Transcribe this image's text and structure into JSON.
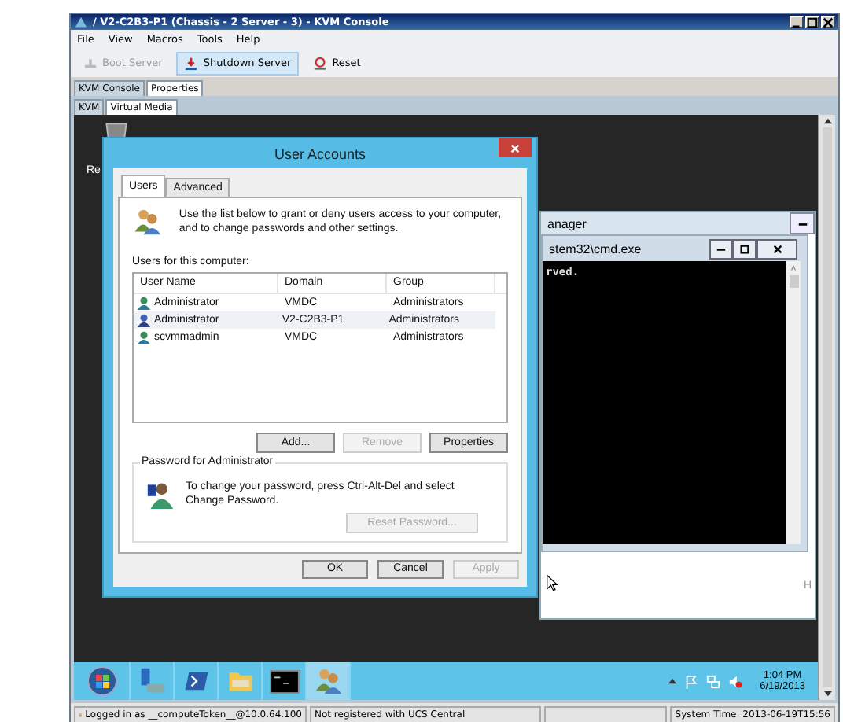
{
  "window": {
    "title": "/ V2-C2B3-P1 (Chassis - 2 Server - 3) - KVM Console"
  },
  "menu": [
    "File",
    "View",
    "Macros",
    "Tools",
    "Help"
  ],
  "toolbar": [
    {
      "label": "Boot Server",
      "kind": "boot",
      "disabled": true,
      "highlighted": false
    },
    {
      "label": "Shutdown Server",
      "kind": "shutdown",
      "disabled": false,
      "highlighted": true
    },
    {
      "label": "Reset",
      "kind": "reset",
      "disabled": false,
      "highlighted": false
    }
  ],
  "tabs": [
    {
      "label": "KVM Console",
      "selected": false
    },
    {
      "label": "Properties",
      "selected": true
    }
  ],
  "subtabs": [
    {
      "label": "KVM",
      "selected": false
    },
    {
      "label": "Virtual Media",
      "selected": true
    }
  ],
  "desktop": {
    "recycle_bin_label": "Re",
    "server_manager": {
      "title": "anager",
      "side_text": "H"
    },
    "cmd": {
      "title": "stem32\\cmd.exe",
      "text": "rved."
    }
  },
  "dialog": {
    "title": "User Accounts",
    "tabs": [
      {
        "label": "Users",
        "selected": true
      },
      {
        "label": "Advanced",
        "selected": false
      }
    ],
    "intro": "Use the list below to grant or deny users access to your computer, and to change passwords and other settings.",
    "list_label": "Users for this computer:",
    "columns": [
      "User Name",
      "Domain",
      "Group"
    ],
    "rows": [
      {
        "name": "Administrator",
        "domain": "VMDC",
        "group": "Administrators",
        "selected": false
      },
      {
        "name": "Administrator",
        "domain": "V2-C2B3-P1",
        "group": "Administrators",
        "selected": true
      },
      {
        "name": "scvmmadmin",
        "domain": "VMDC",
        "group": "Administrators",
        "selected": false
      }
    ],
    "list_buttons": [
      {
        "label": "Add...",
        "disabled": false
      },
      {
        "label": "Remove",
        "disabled": true
      },
      {
        "label": "Properties",
        "disabled": false
      }
    ],
    "password": {
      "title": "Password for Administrator",
      "text": "To change your password, press Ctrl-Alt-Del and select Change Password.",
      "button": {
        "label": "Reset Password...",
        "disabled": true
      }
    },
    "footer_buttons": [
      {
        "label": "OK",
        "disabled": false
      },
      {
        "label": "Cancel",
        "disabled": false
      },
      {
        "label": "Apply",
        "disabled": true
      }
    ]
  },
  "taskbar": {
    "apps": [
      {
        "kind": "start",
        "active": false
      },
      {
        "kind": "server",
        "active": false
      },
      {
        "kind": "powershell",
        "active": false
      },
      {
        "kind": "folder",
        "active": false
      },
      {
        "kind": "console",
        "active": false
      },
      {
        "kind": "users",
        "active": true
      }
    ],
    "time": "1:04 PM",
    "date": "6/19/2013"
  },
  "status_bar": [
    "Logged in as __computeToken__@10.0.64.100",
    "Not registered with UCS Central",
    "System Time: 2013-06-19T15:56"
  ]
}
